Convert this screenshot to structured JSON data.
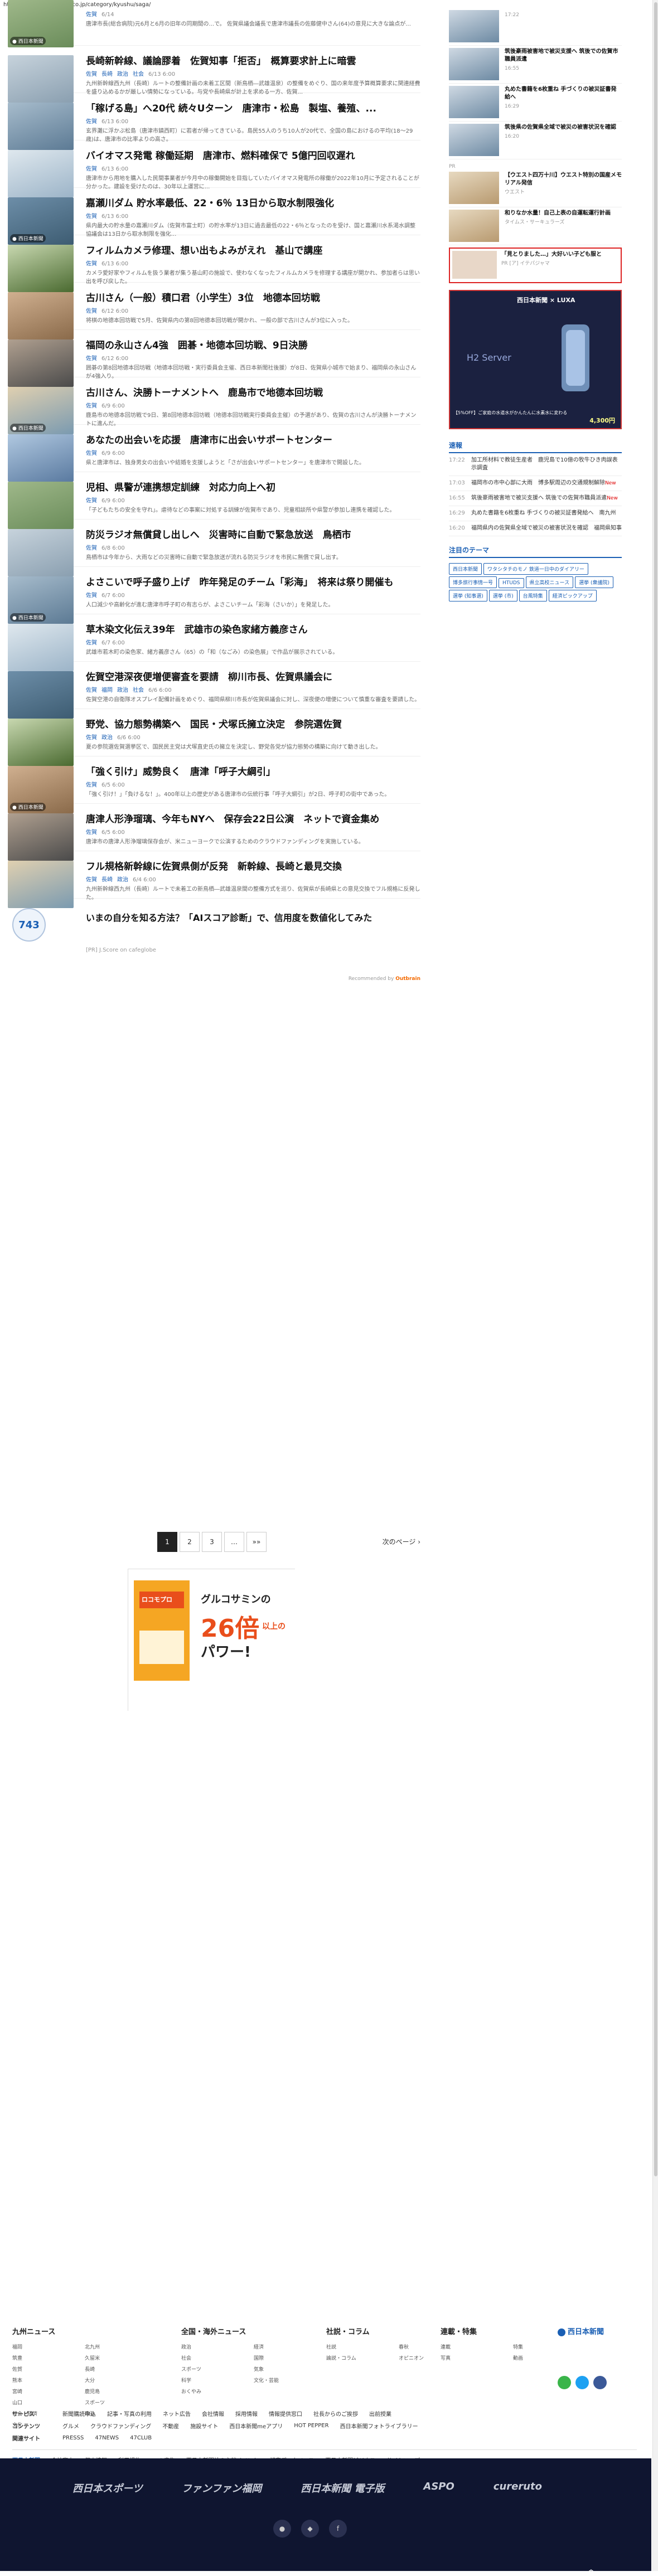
{
  "url": "https://www.nishinippon.co.jp/category/kyushu/saga/",
  "articles": [
    {
      "title": "",
      "tags": [
        "佐賀"
      ],
      "date": "6/14",
      "desc": "唐津市長(総合病院)元6月と6月の旧年の同期間の...で。 佐賀県議会議長で唐津市議長の佐藤健中さん(64)の意見に大きな論点が..."
    },
    {
      "title": "長崎新幹線、議論膠着　佐賀知事「拒否」　概算要求計上に暗雲",
      "tags": [
        "佐賀",
        "長崎",
        "政治",
        "社会"
      ],
      "date": "6/13 6:00",
      "desc": "九州新幹線西九州（長崎）ルートの整備計画の未着工区間（新鳥栖―武雄温泉）の整備をめぐり、国の来年度予算概算要求に関連経費を盛り込めるかが厳しい情勢になっている。与党や長崎県が計上を求める一方、佐賀..."
    },
    {
      "title": "「稼げる島」へ20代 続々Uターン　唐津市・松島　製塩、養殖、...",
      "tags": [
        "佐賀"
      ],
      "date": "6/13 6:00",
      "desc": "玄界灘に浮かぶ松島（唐津市鎮西町）に若者が帰ってきている。島民55人のうち10人が20代で、全国の島におけるの平均(18～29歳)は、唐津市の比率よりの高さ。"
    },
    {
      "title": "バイオマス発電 稼働延期　唐津市、燃料確保で 5億円回収遅れ",
      "tags": [
        "佐賀"
      ],
      "date": "6/13 6:00",
      "desc": "唐津市から用地を購入した民間事業者が今月中の稼働開始を目指していたバイオマス発電所の稼働が2022年10月に予定されることが分かった。建設を受けたのは、30年以上運営に..."
    },
    {
      "title": "嘉瀬川ダム 貯水率最低、22・6％ 13日から取水制限強化",
      "tags": [
        "佐賀"
      ],
      "date": "6/13 6:00",
      "desc": "県内最大の貯水量の嘉瀬川ダム（佐賀市富士町）の貯水率が13日に過去最低の22・6％となったのを受け、国と嘉瀬川水系渇水調整協議会は13日から取水制限を強化..."
    },
    {
      "title": "フィルムカメラ修理、想い出もよみがえれ　基山で講座",
      "tags": [
        "佐賀"
      ],
      "date": "6/13 6:00",
      "desc": "カメラ愛好家やフィルムを扱う業者が集う基山町の施設で、使わなくなったフィルムカメラを修理する講座が開かれ、参加者らは思い出を呼び戻した。"
    },
    {
      "title": "古川さん（一般）積口君（小学生）3位　地德本回坊戦",
      "tags": [
        "佐賀"
      ],
      "date": "6/12 6:00",
      "desc": "将棋の地德本回坊戦で5月、佐賀県内の第8回地德本回坊戦が開かれ、一般の部で古川さんが3位に入った。"
    },
    {
      "title": "福岡の永山さん4強　囲碁・地德本回坊戦、9日決勝",
      "tags": [
        "佐賀"
      ],
      "date": "6/12 6:00",
      "desc": "囲碁の第8回地德本回坊戦（地德本回坊戦・実行委員会主催、西日本新聞社後援）が8日、佐賀県小城市で始まり、福岡県の永山さんが4強入り。"
    },
    {
      "title": "古川さん、決勝トーナメントへ　鹿島市で地德本回坊戦",
      "tags": [
        "佐賀"
      ],
      "date": "6/9 6:00",
      "desc": "鹿島市の地德本回坊戦で9日、第8回地德本回坊戦（地德本回坊戦実行委員会主催）の予選があり、佐賀の古川さんが決勝トーナメントに進んだ。"
    },
    {
      "title": "あなたの出会いを応援　唐津市に出会いサポートセンター",
      "tags": [
        "佐賀"
      ],
      "date": "6/9 6:00",
      "desc": "県と唐津市は、独身男女の出会いや結婚を支援しようと「さが出会いサポートセンター」を唐津市で開設した。"
    },
    {
      "title": "児相、県警が連携想定訓練　対応力向上へ初",
      "tags": [
        "佐賀"
      ],
      "date": "6/9 6:00",
      "desc": "「子どもたちの安全を守れ」。虐待などの事案に対処する訓練が佐賀市であり、児童相談所や県警が参加し連携を確認した。"
    },
    {
      "title": "防災ラジオ無償貸し出しへ　災害時に自動で緊急放送　鳥栖市",
      "tags": [
        "佐賀"
      ],
      "date": "6/8 6:00",
      "desc": "鳥栖市は今年から、大雨などの災害時に自動で緊急放送が流れる防災ラジオを市民に無償で貸し出す。"
    },
    {
      "title": "よさこいで呼子盛り上げ　昨年発足のチーム「彩海」　将来は祭り開催も",
      "tags": [
        "佐賀"
      ],
      "date": "6/7 6:00",
      "desc": "人口減少や高齢化が進む唐津市呼子町の有志らが、よさこいチーム「彩海（さいか）」を発足した。"
    },
    {
      "title": "草木染文化伝え39年　武雄市の染色家緒方義彦さん",
      "tags": [
        "佐賀"
      ],
      "date": "6/7 6:00",
      "desc": "武雄市若木町の染色家、緒方義彦さん（65）の「和（なごみ）の染色展」で作品が展示されている。"
    },
    {
      "title": "佐賀空港深夜便増便審査を要請　柳川市長、佐賀県議会に",
      "tags": [
        "佐賀",
        "福岡",
        "政治",
        "社会"
      ],
      "date": "6/6 6:00",
      "desc": "佐賀空港の自衛隊オスプレイ配備計画をめぐり、福岡県柳川市長が佐賀県議会に対し、深夜便の増便について慎重な審査を要請した。"
    },
    {
      "title": "野党、協力態勢構築へ　国民・犬塚氏擁立決定　参院選佐賀",
      "tags": [
        "佐賀",
        "政治"
      ],
      "date": "6/6 6:00",
      "desc": "夏の参院選佐賀選挙区で、国民民主党は犬塚直史氏の擁立を決定し、野党各党が協力態勢の構築に向けて動き出した。"
    },
    {
      "title": "「強く引け」威勢良く　唐津「呼子大綱引」",
      "tags": [
        "佐賀"
      ],
      "date": "6/5 6:00",
      "desc": "「強く引け！」「負けるな！」。400年以上の歴史がある唐津市の伝統行事「呼子大綱引」が2日、呼子町の街中であった。"
    },
    {
      "title": "唐津人形浄瑠璃、今年もNYへ　保存会22日公演　ネットで資金集め",
      "tags": [
        "佐賀"
      ],
      "date": "6/5 6:00",
      "desc": "唐津市の唐津人形浄瑠璃保存会が、米ニューヨークで公演するためのクラウドファンディングを実施している。"
    },
    {
      "title": "フル規格新幹線に佐賀県側が反発　新幹線、長崎と最見交換",
      "tags": [
        "佐賀",
        "長崎",
        "政治"
      ],
      "date": "6/4 6:00",
      "desc": "九州新幹線西九州（長崎）ルートで未着工の新鳥栖―武雄温泉間の整備方式を巡り、佐賀県が長崎県との意見交換でフル規格に反発した。"
    }
  ],
  "special": {
    "circle": "743",
    "title": "いまの自分を知る方法？「AIスコア診断」で、信用度を数値化してみた",
    "sub": "[PR] J.Score on cafeglobe",
    "recommended_prefix": "Recommended by",
    "recommended_brand": "Outbrain"
  },
  "pagination": {
    "pages": [
      "1",
      "2",
      "3",
      "…",
      "»»"
    ],
    "next": "次のページ"
  },
  "ad": {
    "title": "グルコサミンの",
    "big": "26倍",
    "after": "以上の",
    "power": "パワー!",
    "product": "ロコモプロ"
  },
  "side": {
    "items": [
      {
        "title": "",
        "date": "17:22"
      },
      {
        "title": "筑後豪雨被害地で被災支援へ 筑後での佐賀市職員派遣",
        "date": "16:55"
      },
      {
        "title": "丸めた書籍を6枚重ね 手づくりの被災証書発給へ",
        "date": "16:29"
      },
      {
        "title": "筑後県の佐賀県全域で被災の被害状況を確認",
        "date": "16:20"
      }
    ],
    "pr_label": "PR",
    "pr_items": [
      {
        "title": "【ウエスト四万十川】ウエスト特別の国産メモリアル発信",
        "date": "ウエスト"
      },
      {
        "title": "和りなか水量！自己上表の自運転運行計画",
        "date": "タイムス・サーキュラーズ"
      }
    ],
    "highlight": {
      "title": "「見とりました…」大好いい子ども服と",
      "date": "PR [ア] イテパジャマ"
    },
    "banner": {
      "brand": "西日本新聞",
      "brand2": "LUXA",
      "product": "H2 Server",
      "promo": "【5%OFF】ご家庭の水道水がかんたんに水素水に変わる",
      "price": "4,300円"
    },
    "latest_h": "速報",
    "latest": [
      {
        "t": "17:22",
        "x": "加工所材料で教徒生産者　鹿児島で10億の牧牛ひき肉誤表示調査",
        "new": ""
      },
      {
        "t": "17:03",
        "x": "福岡市の市中心部に大雨　博多駅周辺の交通規制解除",
        "new": "New"
      },
      {
        "t": "16:55",
        "x": "筑後豪雨被害地で被災支援へ 筑後での佐賀市職員派遣",
        "new": "New"
      },
      {
        "t": "16:29",
        "x": "丸めた書籍を6枚重ね 手づくりの被災証書発給へ　南九州",
        "new": ""
      },
      {
        "t": "16:20",
        "x": "福岡県内の佐賀県全域で被災の被害状況を確認　福岡県知事",
        "new": ""
      }
    ],
    "themes_h": "注目のテーマ",
    "themes": [
      "西日本新聞",
      "ワタシタチのモノ 鉄道一日中のダイアリー",
      "博多旅行事情一号",
      "HTUDS",
      "県立高校ニュース",
      "選挙 (衆議院)",
      "選挙 (知事選)",
      "選挙 (市)",
      "台風特集",
      "経済ピックアップ"
    ]
  },
  "footer": {
    "cols": [
      {
        "h": "九州ニュース",
        "items": [
          "福岡",
          "北九州",
          "筑豊",
          "久留米",
          "佐賀",
          "長崎",
          "熊本",
          "大分",
          "宮崎",
          "鹿児島",
          "山口",
          "スポーツ",
          "社会・経済",
          "政治",
          "文化"
        ]
      },
      {
        "h": "全国・海外ニュース",
        "items": [
          "政治",
          "経済",
          "社会",
          "国際",
          "スポーツ",
          "気象",
          "科学",
          "文化・芸能",
          "おくやみ"
        ]
      },
      {
        "h": "社説・コラム",
        "items": [
          "社説",
          "春秋",
          "論説・コラム",
          "オピニオン"
        ]
      },
      {
        "h": "連載・特集",
        "items": [
          "連載",
          "特集",
          "写真",
          "動画"
        ]
      }
    ],
    "brand": "西日本新聞",
    "bars": [
      {
        "label": "サービス",
        "items": [
          "新聞購読申込",
          "記事・写真の利用",
          "ネット広告",
          "会社情報",
          "採用情報",
          "情報提供窓口",
          "社長からのご挨拶",
          "出前授業"
        ]
      },
      {
        "label": "コンテンツ",
        "items": [
          "グルメ",
          "クラウドファンディング",
          "不動産",
          "施設サイト",
          "西日本新聞meアプリ",
          "HOT PEPPER",
          "西日本新聞フォトライブラリー"
        ]
      },
      {
        "label": "関連サイト",
        "items": [
          "PRESSS",
          "47NEWS",
          "47CLUB"
        ]
      }
    ],
    "bottom": [
      "西日本新聞",
      "会社案内",
      "個人情報",
      "利用規約",
      "Web広告",
      "西日本新聞社の主催イベント",
      "記事データベース",
      "西日本新聞ビジネス",
      "サイトマップ"
    ],
    "logos": [
      "西日本スポーツ",
      "ファンファン福岡",
      "西日本新聞 電子版",
      "ASPO",
      "cureruto"
    ]
  }
}
